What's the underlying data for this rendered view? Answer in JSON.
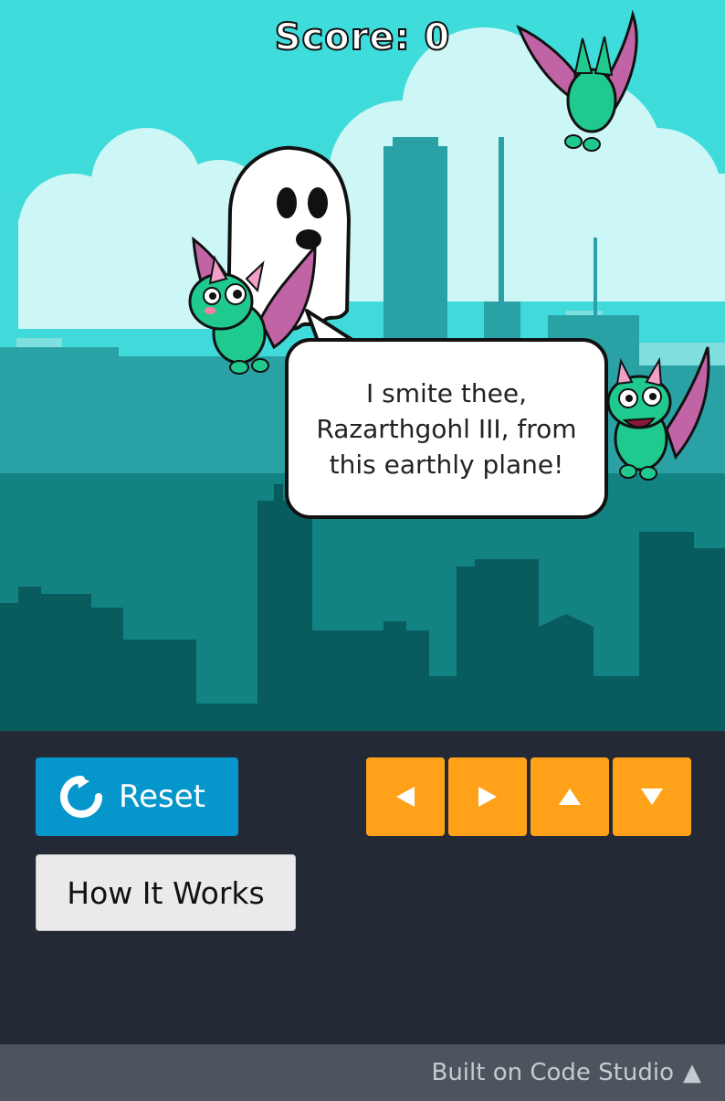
{
  "game": {
    "score_label": "Score: 0",
    "speech_bubble": "I smite thee, Razarthgohl III, from this earthly plane!",
    "characters": [
      "ghost-sprite",
      "bat-sprite",
      "bat-sprite",
      "bat-sprite"
    ]
  },
  "controls": {
    "reset_label": "Reset",
    "how_it_works_label": "How It Works",
    "arrows": [
      "left-arrow-icon",
      "right-arrow-icon",
      "up-arrow-icon",
      "down-arrow-icon"
    ]
  },
  "footer": {
    "label": "Built on Code Studio",
    "caret": "▲"
  },
  "colors": {
    "sky": "#40d9d9",
    "reset_button": "#0596cc",
    "arrow_buttons": "#ffa21a",
    "panel": "#232a35",
    "footer": "#4c555e"
  }
}
